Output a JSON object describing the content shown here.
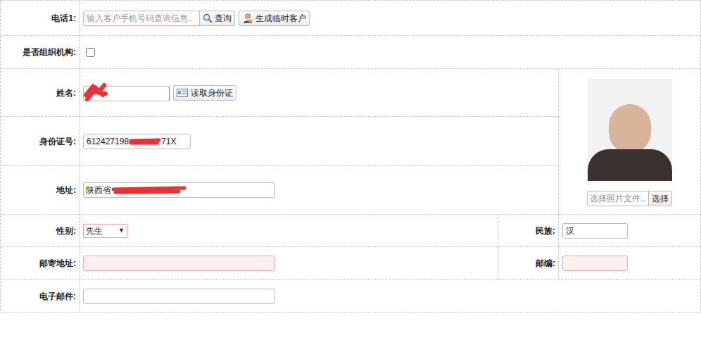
{
  "phone": {
    "label": "电话1:",
    "placeholder": "输入客户手机号码查询信息..",
    "search_button": "查询",
    "temp_button": "生成临时客户"
  },
  "organization": {
    "label": "是否组织机构:",
    "checked": false
  },
  "name": {
    "label": "姓名:",
    "read_button": "读取身份证"
  },
  "id_number": {
    "label": "身份证号:",
    "value_start": "612427198",
    "value_end": "71X"
  },
  "address": {
    "label": "地址:",
    "value": "陕西省"
  },
  "photo": {
    "placeholder": "选择照片文件..",
    "button": "选择"
  },
  "gender": {
    "label": "性别:",
    "value": "先生",
    "arrow": "▼"
  },
  "ethnicity": {
    "label": "民族:",
    "value": "汉"
  },
  "mail_address": {
    "label": "邮寄地址:"
  },
  "postcode": {
    "label": "邮编:"
  },
  "email": {
    "label": "电子邮件:"
  }
}
